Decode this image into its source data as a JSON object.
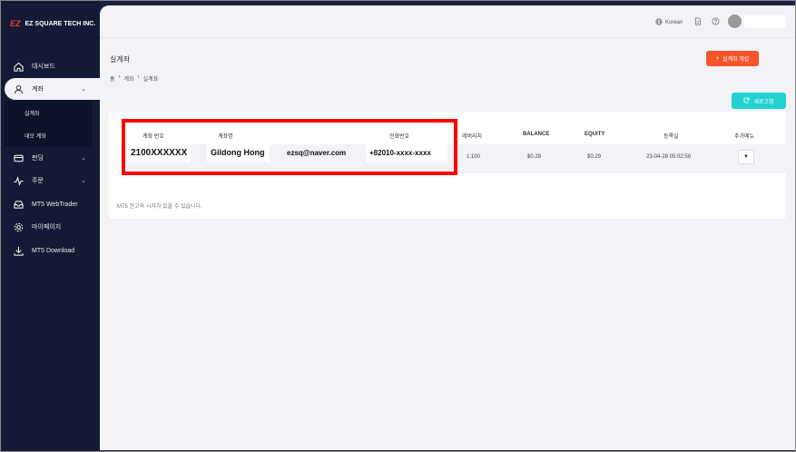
{
  "sidebar": {
    "logo_mark": "EZ",
    "logo_text": "EZ SQUARE TECH INC.",
    "items": [
      {
        "label": "대시보드",
        "icon": "home-icon"
      },
      {
        "label": "계좌",
        "icon": "user-icon"
      },
      {
        "label": "펀딩",
        "icon": "card-icon"
      },
      {
        "label": "주문",
        "icon": "chart-icon"
      },
      {
        "label": "MT5 WebTrader",
        "icon": "tray-icon"
      },
      {
        "label": "마이페이지",
        "icon": "gear-icon"
      },
      {
        "label": "MT5 Download",
        "icon": "download-icon"
      }
    ],
    "submenu": [
      "실계좌",
      "데모 계좌"
    ]
  },
  "topbar": {
    "language": "Korean"
  },
  "page": {
    "title": "실계좌",
    "breadcrumb": [
      "홈",
      "계좌",
      "실계좌"
    ],
    "open_button": "실계좌 개설",
    "refresh_button": "새로고침",
    "note": "MT5 잔고와 시차가 있을 수 있습니다."
  },
  "table": {
    "headers": [
      "계좌 번호",
      "계좌명",
      "전화번호",
      "레버리지",
      "BALANCE",
      "EQUITY",
      "등록일",
      "추가메뉴"
    ],
    "rows": [
      {
        "account_no": "2100XXXXXX",
        "name": "Gildong Hong",
        "email": "ezsq@naver.com",
        "phone": "+82010-xxxx-xxxx",
        "leverage": "1:100",
        "balance": "$0.29",
        "equity": "$0.29",
        "registered": "23-04-28 05:02:58",
        "more": "▼"
      }
    ]
  },
  "colors": {
    "sidebar": "#141a36",
    "accent_orange": "#f5542d",
    "accent_cyan": "#22d2d2",
    "highlight": "#ff0000"
  }
}
